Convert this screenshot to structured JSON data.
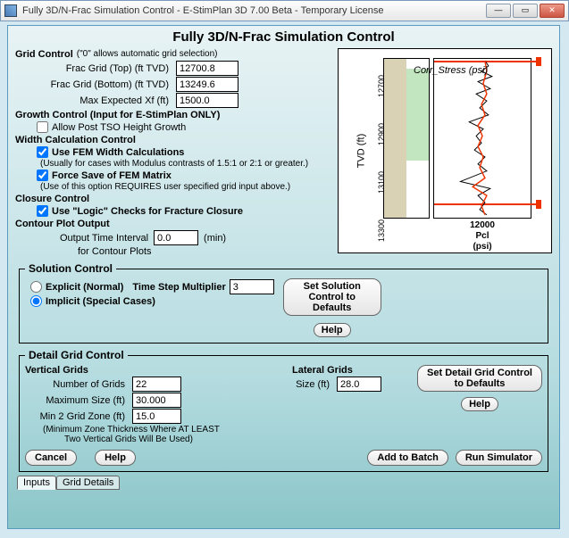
{
  "window": {
    "title": "Fully 3D/N-Frac Simulation Control - E-StimPlan 3D 7.00 Beta - Temporary License"
  },
  "page_title": "Fully 3D/N-Frac Simulation Control",
  "grid_control": {
    "heading": "Grid Control",
    "hint": "(\"0\" allows automatic grid selection)",
    "frac_top_label": "Frac Grid (Top) (ft TVD)",
    "frac_top_value": "12700.8",
    "frac_bot_label": "Frac Grid (Bottom) (ft TVD)",
    "frac_bot_value": "13249.6",
    "max_xf_label": "Max Expected Xf (ft)",
    "max_xf_value": "1500.0"
  },
  "growth_control": {
    "heading": "Growth Control (Input for E-StimPlan ONLY)",
    "allow_tso_label": "Allow Post TSO Height Growth",
    "allow_tso_checked": false
  },
  "width_control": {
    "heading": "Width Calculation Control",
    "use_fem_label": "Use FEM Width Calculations",
    "use_fem_note": "(Usually for cases with Modulus contrasts of 1.5:1 or 2:1 or greater.)",
    "force_save_label": "Force Save of FEM Matrix",
    "force_save_note": "(Use of this option REQUIRES user specified grid input above.)"
  },
  "closure_control": {
    "heading": "Closure Control",
    "use_logic_label": "Use \"Logic\" Checks for Fracture Closure"
  },
  "contour_output": {
    "heading": "Contour Plot Output",
    "interval_label": "Output Time Interval",
    "interval_value": "0.0",
    "interval_unit": "(min)",
    "interval_sub": "for Contour Plots"
  },
  "solution_control": {
    "legend": "Solution Control",
    "explicit_label": "Explicit (Normal)",
    "implicit_label": "Implicit (Special Cases)",
    "multiplier_label": "Time Step Multiplier",
    "multiplier_value": "3",
    "defaults_btn": "Set Solution Control to Defaults",
    "help_btn": "Help"
  },
  "detail_grid": {
    "legend": "Detail Grid Control",
    "vert_heading": "Vertical Grids",
    "num_grids_label": "Number of Grids",
    "num_grids_value": "22",
    "max_size_label": "Maximum Size (ft)",
    "max_size_value": "30.000",
    "min2_label": "Min 2 Grid Zone (ft)",
    "min2_value": "15.0",
    "min2_note1": "(Minimum Zone Thickness Where AT LEAST",
    "min2_note2": "Two Vertical Grids Will Be Used)",
    "lat_heading": "Lateral Grids",
    "lat_size_label": "Size (ft)",
    "lat_size_value": "28.0",
    "defaults_btn": "Set Detail Grid Control to Defaults",
    "help_btn": "Help",
    "cancel_btn": "Cancel",
    "help2_btn": "Help",
    "add_batch_btn": "Add to Batch",
    "run_btn": "Run Simulator"
  },
  "tabs": {
    "inputs": "Inputs",
    "grid_details": "Grid Details"
  },
  "chart_data": {
    "type": "line",
    "title": "Corr_Stress (psi)",
    "ylabel": "TVD (ft)",
    "yticks": [
      "12700",
      "12900",
      "13100",
      "13300"
    ],
    "xlabel1": "Pcl",
    "xlabel2": "(psi)",
    "xtick": "12000",
    "frac_top_line": 12700.8,
    "frac_bot_line": 13249.6
  }
}
